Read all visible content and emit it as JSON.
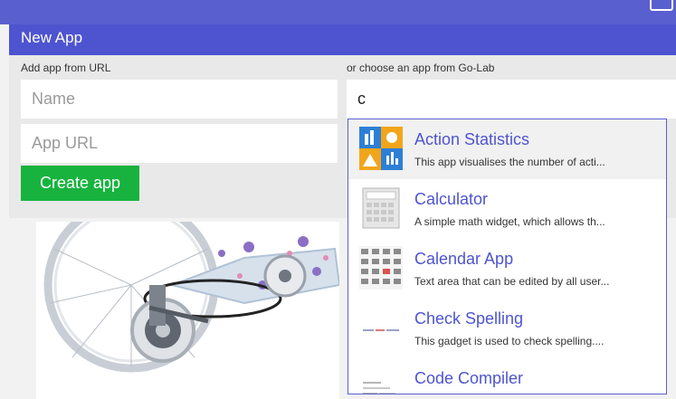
{
  "panel": {
    "title": "New App"
  },
  "left_column": {
    "label": "Add app from URL",
    "name_placeholder": "Name",
    "url_placeholder": "App URL",
    "create_button": "Create app"
  },
  "right_column": {
    "label": "or choose an app from Go-Lab",
    "search_value": "c"
  },
  "suggestions": [
    {
      "title": "Action Statistics",
      "description": "This app visualises the number of acti...",
      "thumbnail": "statistics-thumbnail"
    },
    {
      "title": "Calculator",
      "description": "A simple math widget, which allows th...",
      "thumbnail": "calculator-thumbnail"
    },
    {
      "title": "Calendar App",
      "description": "Text area that can be edited by all user...",
      "thumbnail": "calendar-thumbnail"
    },
    {
      "title": "Check Spelling",
      "description": "This gadget is used to check spelling....",
      "thumbnail": "spelling-thumbnail"
    },
    {
      "title": "Code Compiler",
      "description": "",
      "thumbnail": "compiler-thumbnail"
    }
  ],
  "colors": {
    "accent": "#4e54cf",
    "create_button": "#18b33e",
    "form_background": "#e9e9e9"
  }
}
